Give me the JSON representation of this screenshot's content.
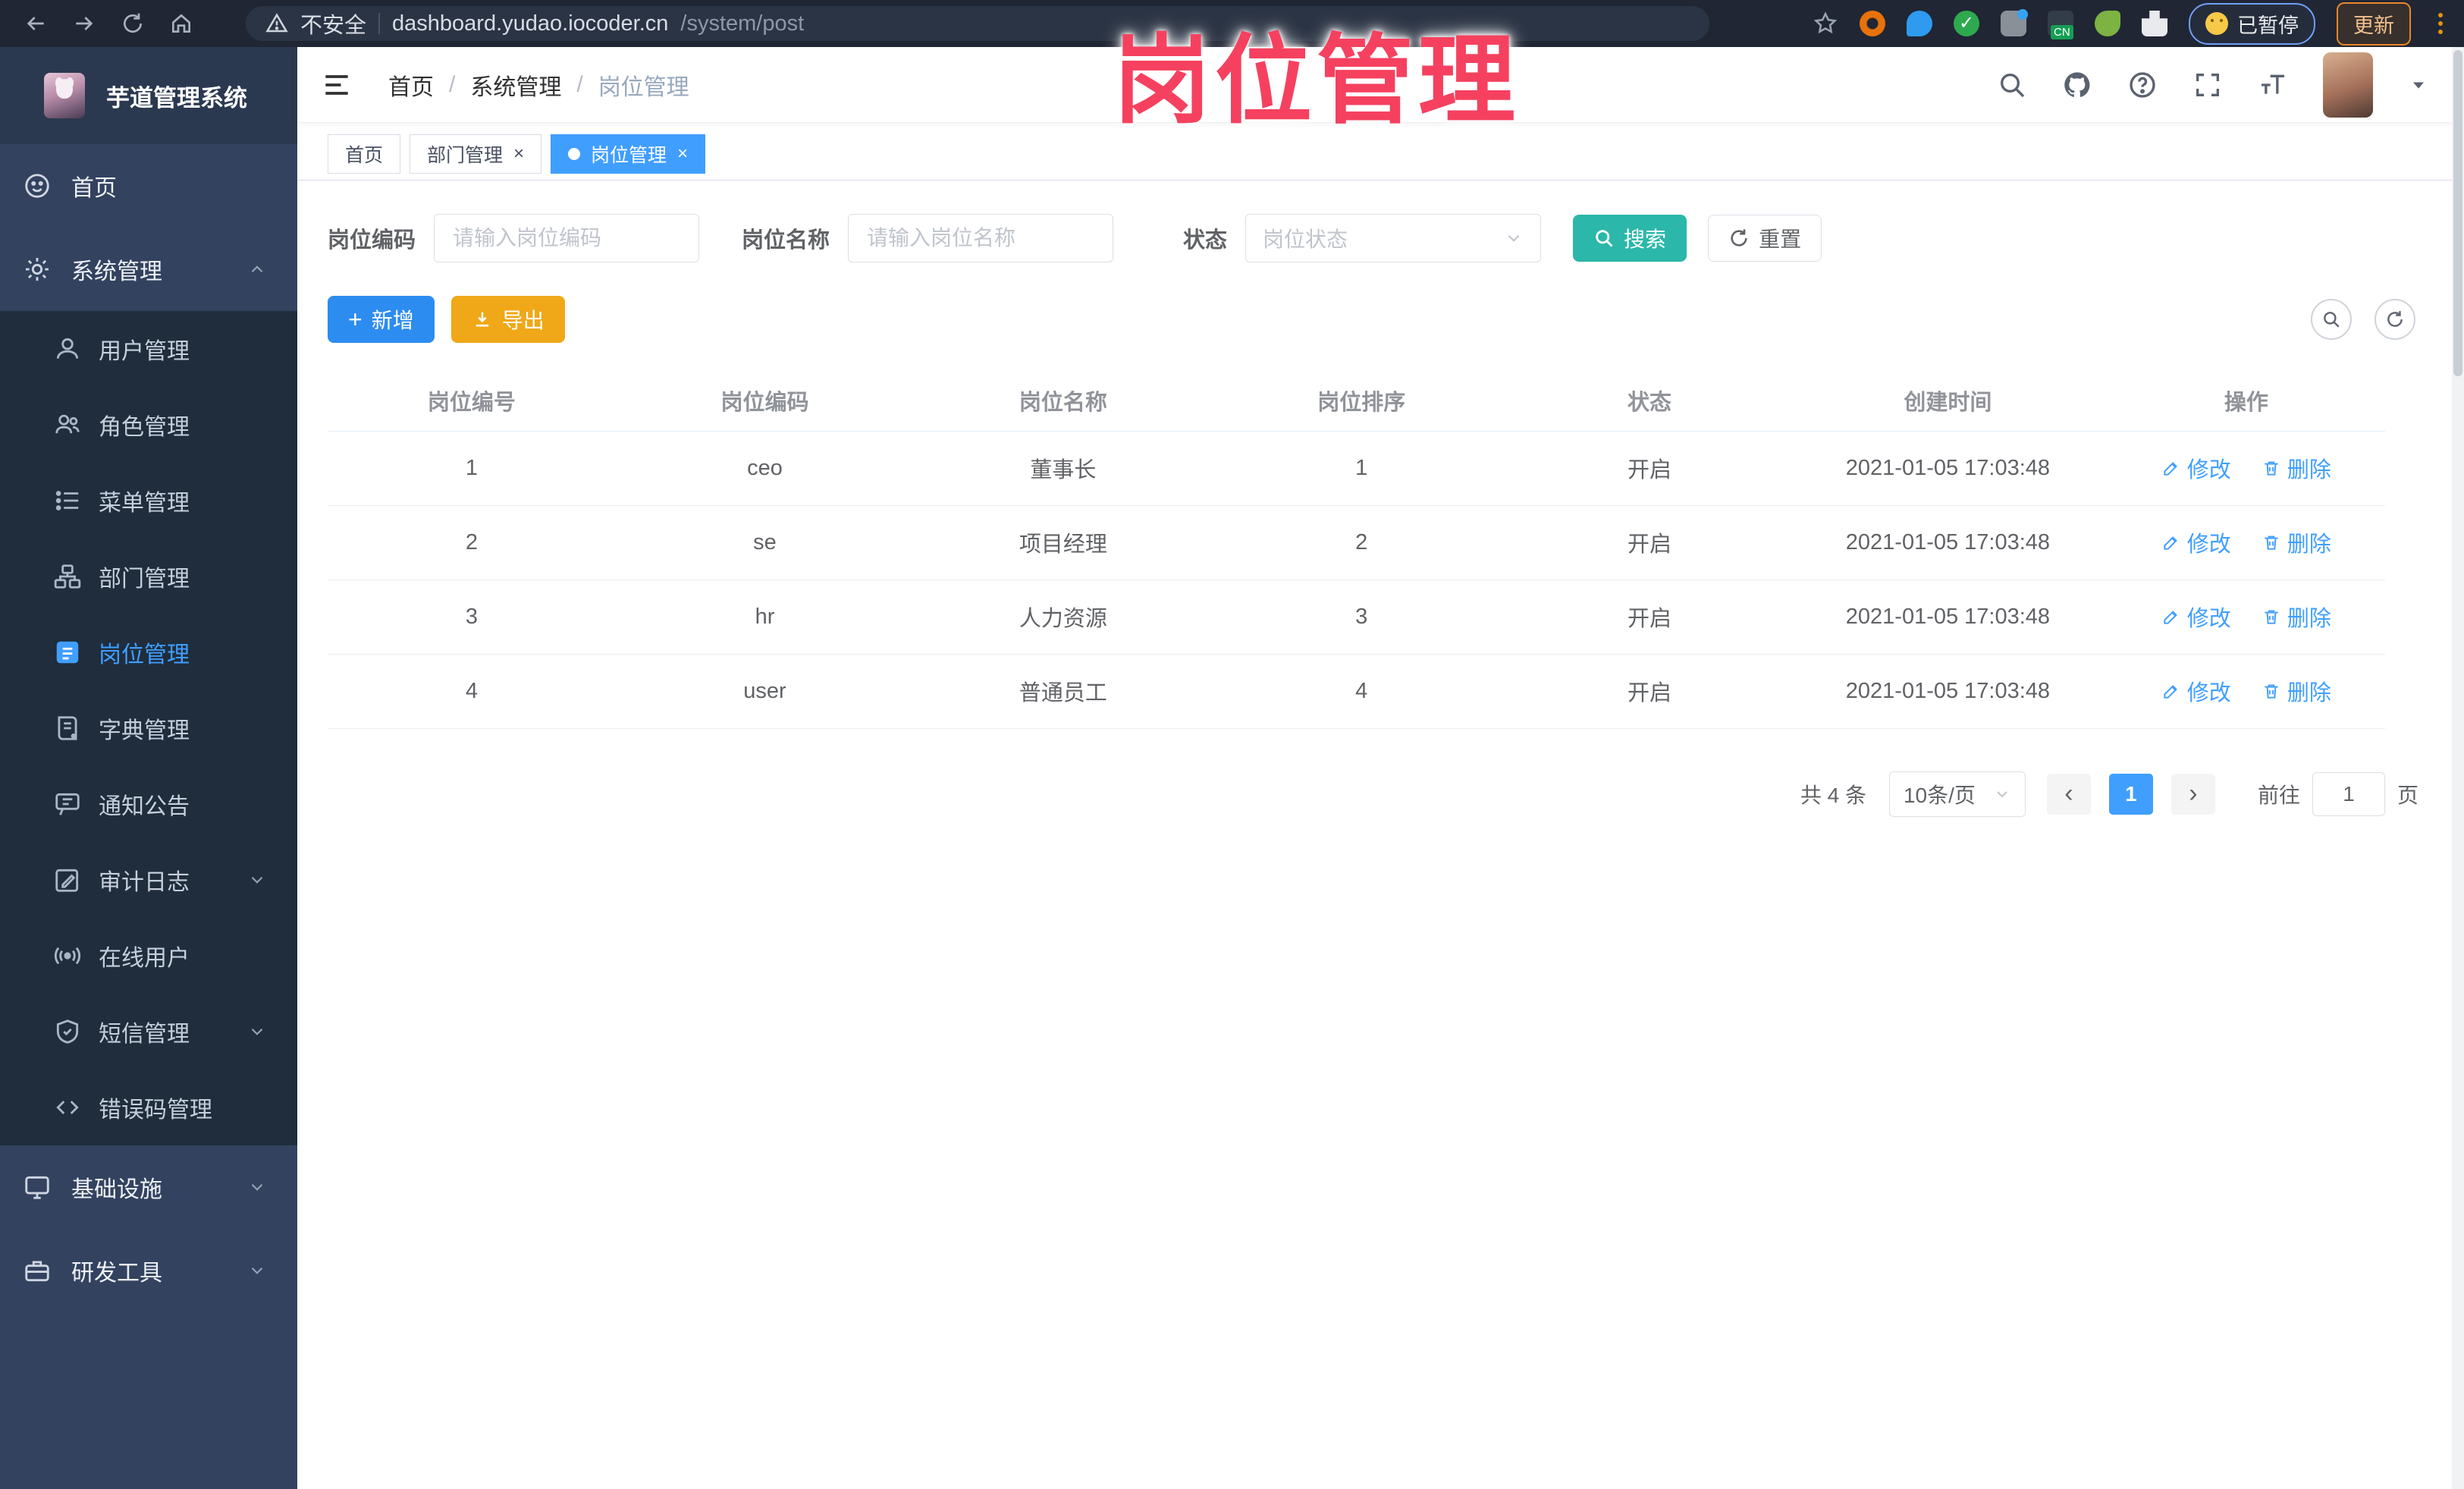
{
  "browser": {
    "security_label": "不安全",
    "url_host": "dashboard.yudao.iocoder.cn",
    "url_path": "/system/post",
    "paused_badge": "已暂停",
    "update_button": "更新",
    "extension_icons": [
      "orange-ring-extension",
      "blue-pin-extension",
      "green-check-extension",
      "gray-blue-dot-extension",
      "cn-badge-extension",
      "green-leaf-extension",
      "puzzle-extension"
    ]
  },
  "app": {
    "title": "芋道管理系统"
  },
  "sidebar": {
    "items": [
      {
        "label": "首页",
        "icon": "home-icon",
        "level": "top"
      },
      {
        "label": "系统管理",
        "icon": "gear-icon",
        "level": "top",
        "expanded": true
      },
      {
        "label": "用户管理",
        "icon": "user-icon",
        "level": "sub"
      },
      {
        "label": "角色管理",
        "icon": "role-icon",
        "level": "sub"
      },
      {
        "label": "菜单管理",
        "icon": "menu-list-icon",
        "level": "sub"
      },
      {
        "label": "部门管理",
        "icon": "dept-tree-icon",
        "level": "sub"
      },
      {
        "label": "岗位管理",
        "icon": "post-icon",
        "level": "sub",
        "active": true
      },
      {
        "label": "字典管理",
        "icon": "dict-icon",
        "level": "sub"
      },
      {
        "label": "通知公告",
        "icon": "notice-icon",
        "level": "sub"
      },
      {
        "label": "审计日志",
        "icon": "audit-icon",
        "level": "sub",
        "collapsible": true
      },
      {
        "label": "在线用户",
        "icon": "online-icon",
        "level": "sub"
      },
      {
        "label": "短信管理",
        "icon": "sms-icon",
        "level": "sub",
        "collapsible": true
      },
      {
        "label": "错误码管理",
        "icon": "error-code-icon",
        "level": "sub"
      },
      {
        "label": "基础设施",
        "icon": "infra-icon",
        "level": "top",
        "collapsible": true
      },
      {
        "label": "研发工具",
        "icon": "tools-icon",
        "level": "top",
        "collapsible": true
      }
    ]
  },
  "navbar": {
    "breadcrumb": {
      "items": [
        "首页",
        "系统管理",
        "岗位管理"
      ],
      "separator": "/"
    },
    "icons": [
      "search-icon",
      "github-icon",
      "help-icon",
      "fullscreen-icon",
      "font-size-icon"
    ]
  },
  "tabs": [
    {
      "label": "首页",
      "closable": false,
      "active": false
    },
    {
      "label": "部门管理",
      "closable": true,
      "active": false
    },
    {
      "label": "岗位管理",
      "closable": true,
      "active": true
    }
  ],
  "watermark": "岗位管理",
  "filters": {
    "post_code": {
      "label": "岗位编码",
      "placeholder": "请输入岗位编码",
      "value": ""
    },
    "post_name": {
      "label": "岗位名称",
      "placeholder": "请输入岗位名称",
      "value": ""
    },
    "status": {
      "label": "状态",
      "placeholder": "岗位状态"
    },
    "search_button": "搜索",
    "reset_button": "重置"
  },
  "toolbar": {
    "add_button": "新增",
    "export_button": "导出"
  },
  "table": {
    "columns": [
      "岗位编号",
      "岗位编码",
      "岗位名称",
      "岗位排序",
      "状态",
      "创建时间",
      "操作"
    ],
    "rows": [
      {
        "id": "1",
        "code": "ceo",
        "name": "董事长",
        "sort": "1",
        "status": "开启",
        "created": "2021-01-05 17:03:48",
        "edit": "修改",
        "delete": "删除"
      },
      {
        "id": "2",
        "code": "se",
        "name": "项目经理",
        "sort": "2",
        "status": "开启",
        "created": "2021-01-05 17:03:48",
        "edit": "修改",
        "delete": "删除"
      },
      {
        "id": "3",
        "code": "hr",
        "name": "人力资源",
        "sort": "3",
        "status": "开启",
        "created": "2021-01-05 17:03:48",
        "edit": "修改",
        "delete": "删除"
      },
      {
        "id": "4",
        "code": "user",
        "name": "普通员工",
        "sort": "4",
        "status": "开启",
        "created": "2021-01-05 17:03:48",
        "edit": "修改",
        "delete": "删除"
      }
    ]
  },
  "pagination": {
    "total": "共 4 条",
    "page_size": "10条/页",
    "current_page": "1",
    "goto_label": "前往",
    "goto_value": "1",
    "page_unit": "页"
  },
  "glyphs": {
    "close": "×",
    "prev": "‹",
    "next": "›",
    "plus": "+"
  },
  "colors": {
    "primary": "#409EFF",
    "add_blue": "#2D8CF0",
    "search_teal": "#2BB7A9",
    "export_orange": "#F0A818",
    "watermark_pink": "#F5415F",
    "sidebar_dark": "#1f2d3c",
    "sidebar_base": "#33425f"
  }
}
